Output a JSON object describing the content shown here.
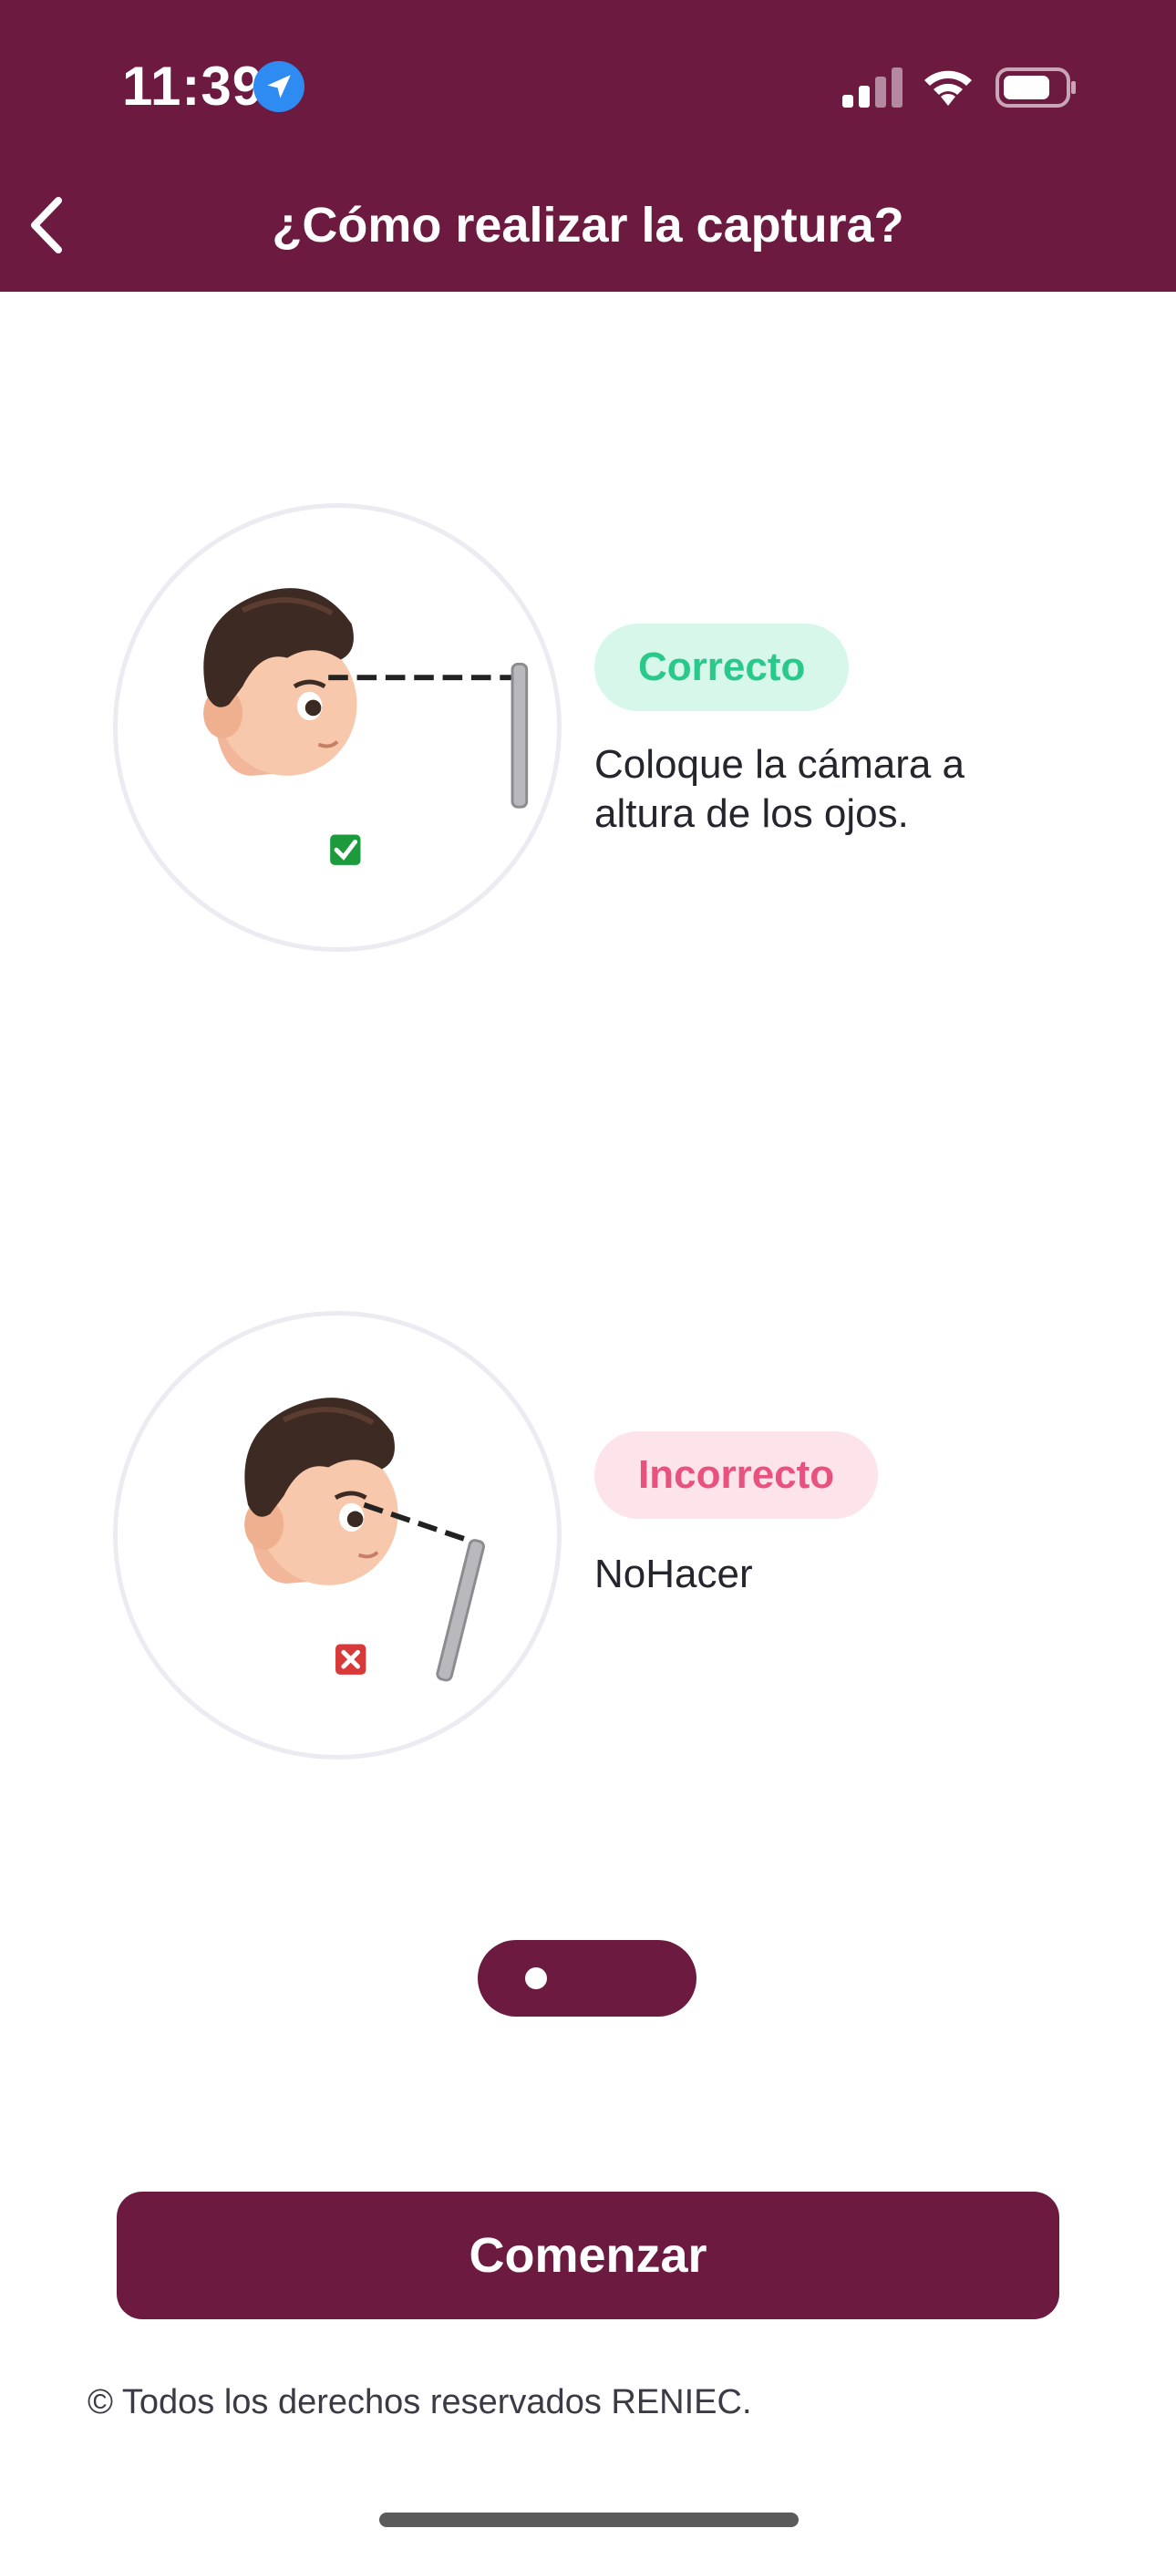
{
  "status_bar": {
    "time": "11:39"
  },
  "header": {
    "title": "¿Cómo realizar la captura?"
  },
  "instructions": [
    {
      "badge": "Correcto",
      "description": "Coloque la cámara a altura de los ojos.",
      "color": "#2ac98b"
    },
    {
      "badge": "Incorrecto",
      "description": "NoHacer",
      "color": "#e9517f"
    }
  ],
  "pager": {
    "active_index": 0,
    "total": 2
  },
  "actions": {
    "start_label": "Comenzar"
  },
  "footer": {
    "copyright": "© Todos los derechos reservados RENIEC."
  },
  "colors": {
    "brand": "#6d1a41",
    "correct_bg": "#d7f7ea",
    "incorrect_bg": "#fde3ea"
  }
}
